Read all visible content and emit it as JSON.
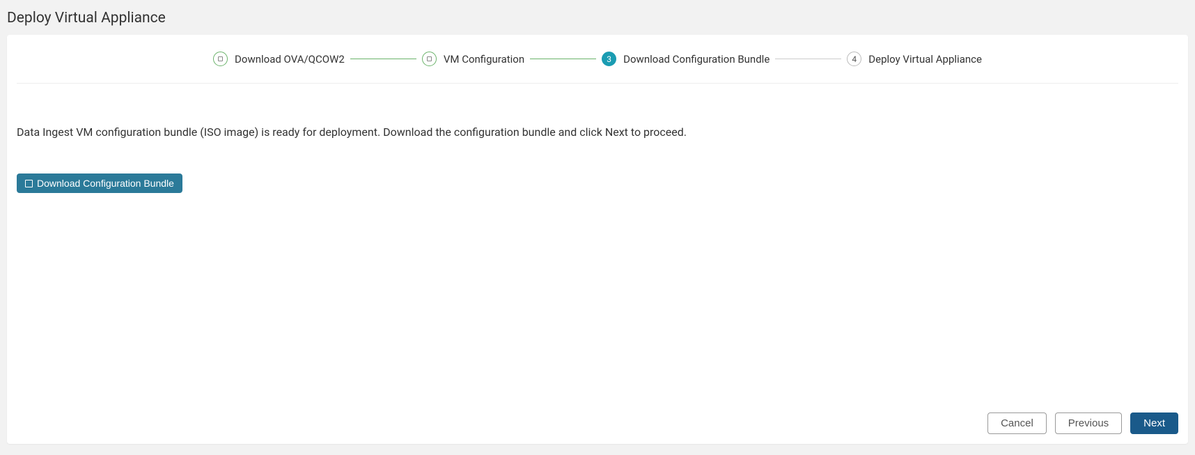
{
  "title": "Deploy Virtual Appliance",
  "steps": {
    "s1": {
      "label": "Download OVA/QCOW2"
    },
    "s2": {
      "label": "VM Configuration"
    },
    "s3": {
      "num": "3",
      "label": "Download Configuration Bundle"
    },
    "s4": {
      "num": "4",
      "label": "Deploy Virtual Appliance"
    }
  },
  "body": {
    "message": "Data Ingest VM configuration bundle (ISO image) is ready for deployment. Download the configuration bundle and click Next to proceed.",
    "download_label": "Download Configuration Bundle"
  },
  "footer": {
    "cancel": "Cancel",
    "previous": "Previous",
    "next": "Next"
  }
}
